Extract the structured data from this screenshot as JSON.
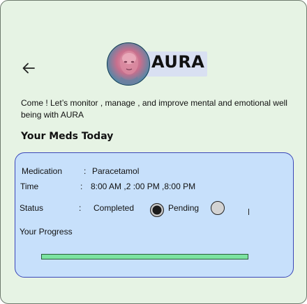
{
  "header": {
    "back_icon": "arrow-left-icon",
    "avatar_icon": "ai-face-avatar",
    "app_title": "AURA"
  },
  "intro_text": "Come ! Let’s  monitor , manage , and improve  mental and emotional well being with AURA",
  "meds_section_title": "Your Meds Today",
  "med_card": {
    "medication_label": "Medication",
    "medication_sep": ":",
    "medication_value": "Paracetamol",
    "time_label": "Time",
    "time_sep": ":",
    "time_value": "8:00 AM ,2 :00 PM ,8:00 PM",
    "status_label": "Status",
    "status_sep": ":",
    "status_options": [
      {
        "label": "Completed",
        "selected": true
      },
      {
        "label": "Pending",
        "selected": false
      }
    ],
    "progress_label": "Your Progress",
    "progress_fraction": 1.0,
    "colors": {
      "card_bg": "#c7e0fb",
      "card_border": "#3a46b8",
      "progress": "#7be3a0"
    }
  }
}
